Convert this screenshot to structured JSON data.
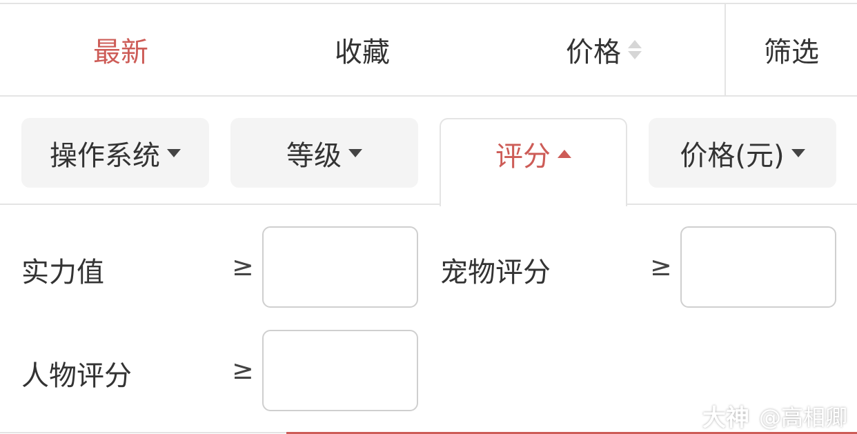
{
  "sort_bar": {
    "items": [
      {
        "label": "最新"
      },
      {
        "label": "收藏"
      },
      {
        "label": "价格"
      },
      {
        "label": "筛选"
      }
    ]
  },
  "filter_tabs": [
    {
      "label": "操作系统"
    },
    {
      "label": "等级"
    },
    {
      "label": "评分"
    },
    {
      "label": "价格(元)"
    }
  ],
  "rating_fields": [
    {
      "label": "实力值",
      "operator": "≥",
      "value": ""
    },
    {
      "label": "宠物评分",
      "operator": "≥",
      "value": ""
    },
    {
      "label": "人物评分",
      "operator": "≥",
      "value": ""
    }
  ],
  "watermark": {
    "logo": "大神",
    "user": "@高相卿"
  },
  "colors": {
    "accent": "#cd5c57",
    "text": "#333333",
    "border": "#e4e4e4",
    "tab_bg": "#f4f4f4"
  }
}
